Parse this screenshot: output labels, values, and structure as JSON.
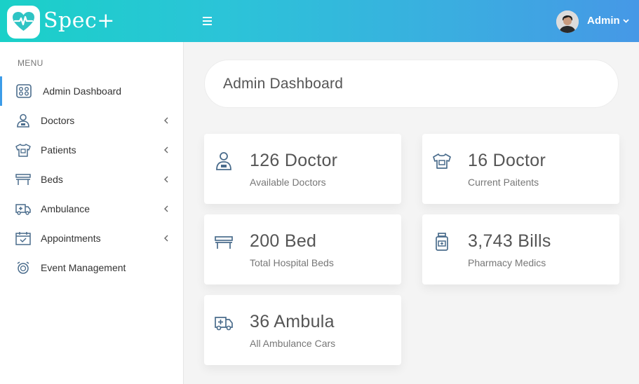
{
  "header": {
    "brand": "Spec+",
    "user_name": "Admin",
    "accent_start": "#1ad0c8",
    "accent_end": "#4698e6"
  },
  "sidebar": {
    "menu_label": "MENU",
    "items": [
      {
        "label": "Admin Dashboard",
        "icon": "dashboard-icon",
        "active": true,
        "has_submenu": false
      },
      {
        "label": "Doctors",
        "icon": "doctor-icon",
        "active": false,
        "has_submenu": true
      },
      {
        "label": "Patients",
        "icon": "patient-icon",
        "active": false,
        "has_submenu": true
      },
      {
        "label": "Beds",
        "icon": "bed-icon",
        "active": false,
        "has_submenu": true
      },
      {
        "label": "Ambulance",
        "icon": "ambulance-icon",
        "active": false,
        "has_submenu": true
      },
      {
        "label": "Appointments",
        "icon": "calendar-icon",
        "active": false,
        "has_submenu": true
      },
      {
        "label": "Event Management",
        "icon": "alarm-clock-icon",
        "active": false,
        "has_submenu": false
      }
    ]
  },
  "main": {
    "title": "Admin Dashboard",
    "stats": [
      {
        "value": "126 Doctor",
        "label": "Available Doctors",
        "icon": "doctor-icon"
      },
      {
        "value": "16 Doctor",
        "label": "Current Paitents",
        "icon": "patient-shirt-icon"
      },
      {
        "value": "200 Bed",
        "label": "Total Hospital Beds",
        "icon": "bed-icon"
      },
      {
        "value": "3,743 Bills",
        "label": "Pharmacy Medics",
        "icon": "medicine-bottle-icon"
      },
      {
        "value": "36 Ambula",
        "label": "All Ambulance Cars",
        "icon": "ambulance-icon"
      }
    ]
  }
}
